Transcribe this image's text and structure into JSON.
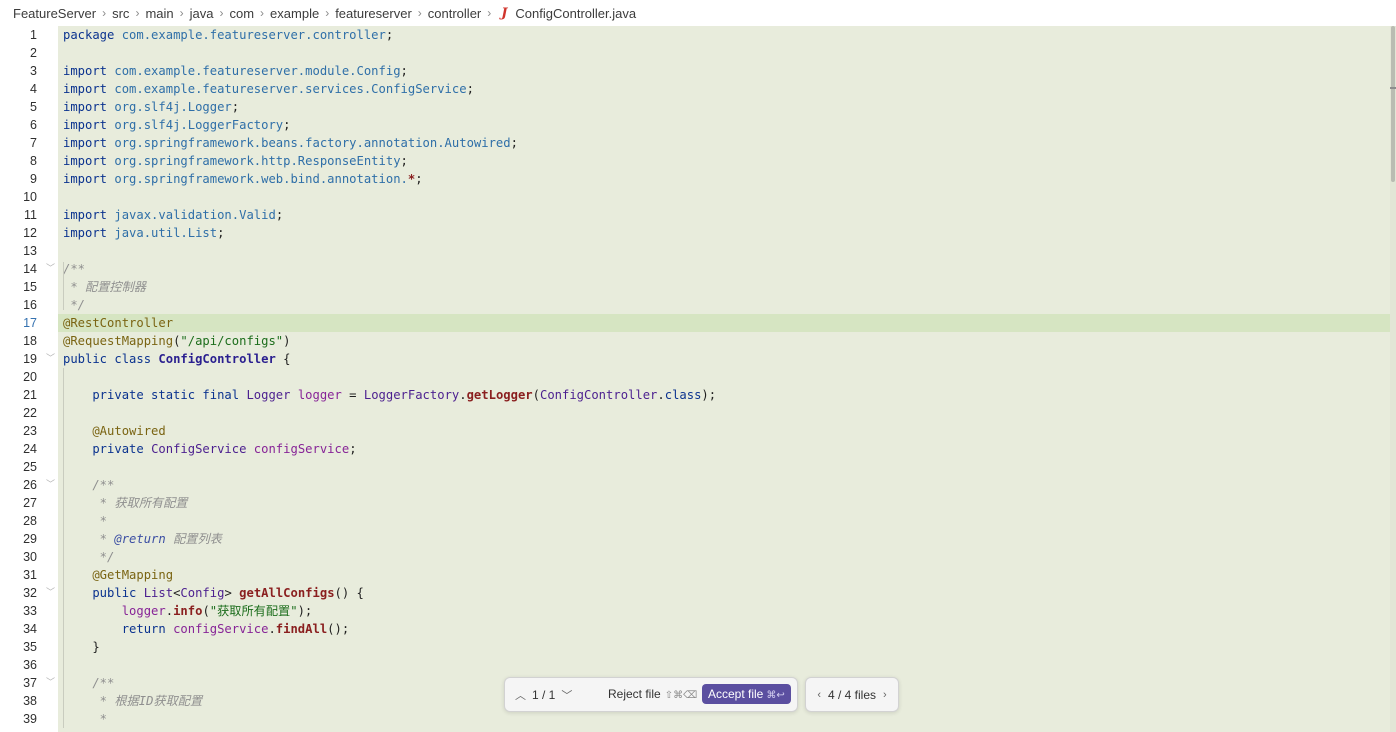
{
  "breadcrumb": {
    "items": [
      "FeatureServer",
      "src",
      "main",
      "java",
      "com",
      "example",
      "featureserver",
      "controller"
    ],
    "file_icon": "J",
    "file_name": "ConfigController.java"
  },
  "editor": {
    "current_line": 17,
    "lines": [
      {
        "n": "1",
        "t": [
          [
            "kw",
            "package "
          ],
          [
            "pk",
            "com.example.featureserver.controller"
          ],
          [
            "plain",
            ";"
          ]
        ]
      },
      {
        "n": "2",
        "t": []
      },
      {
        "n": "3",
        "t": [
          [
            "kw",
            "import "
          ],
          [
            "pk",
            "com.example.featureserver.module.Config"
          ],
          [
            "plain",
            ";"
          ]
        ]
      },
      {
        "n": "4",
        "t": [
          [
            "kw",
            "import "
          ],
          [
            "pk",
            "com.example.featureserver.services.ConfigService"
          ],
          [
            "plain",
            ";"
          ]
        ]
      },
      {
        "n": "5",
        "t": [
          [
            "kw",
            "import "
          ],
          [
            "pk",
            "org.slf4j.Logger"
          ],
          [
            "plain",
            ";"
          ]
        ]
      },
      {
        "n": "6",
        "t": [
          [
            "kw",
            "import "
          ],
          [
            "pk",
            "org.slf4j.LoggerFactory"
          ],
          [
            "plain",
            ";"
          ]
        ]
      },
      {
        "n": "7",
        "t": [
          [
            "kw",
            "import "
          ],
          [
            "pk",
            "org.springframework.beans.factory.annotation.Autowired"
          ],
          [
            "plain",
            ";"
          ]
        ]
      },
      {
        "n": "8",
        "t": [
          [
            "kw",
            "import "
          ],
          [
            "pk",
            "org.springframework.http.ResponseEntity"
          ],
          [
            "plain",
            ";"
          ]
        ]
      },
      {
        "n": "9",
        "t": [
          [
            "kw",
            "import "
          ],
          [
            "pk",
            "org.springframework.web.bind.annotation."
          ],
          [
            "mth",
            "*"
          ],
          [
            "plain",
            ";"
          ]
        ]
      },
      {
        "n": "10",
        "t": []
      },
      {
        "n": "11",
        "t": [
          [
            "kw",
            "import "
          ],
          [
            "pk",
            "javax.validation.Valid"
          ],
          [
            "plain",
            ";"
          ]
        ]
      },
      {
        "n": "12",
        "t": [
          [
            "kw",
            "import "
          ],
          [
            "pk",
            "java.util.List"
          ],
          [
            "plain",
            ";"
          ]
        ]
      },
      {
        "n": "13",
        "t": []
      },
      {
        "n": "14",
        "fold": true,
        "t": [
          [
            "cmt",
            "/**"
          ]
        ]
      },
      {
        "n": "15",
        "t": [
          [
            "cmt",
            " * 配置控制器"
          ]
        ]
      },
      {
        "n": "16",
        "t": [
          [
            "cmt",
            " */"
          ]
        ]
      },
      {
        "n": "17",
        "t": [
          [
            "ann",
            "@RestController"
          ]
        ]
      },
      {
        "n": "18",
        "t": [
          [
            "ann",
            "@RequestMapping"
          ],
          [
            "plain",
            "("
          ],
          [
            "str",
            "\"/api/configs\""
          ],
          [
            "plain",
            ")"
          ]
        ]
      },
      {
        "n": "19",
        "fold": true,
        "t": [
          [
            "kw",
            "public class "
          ],
          [
            "cls",
            "ConfigController "
          ],
          [
            "plain",
            "{"
          ]
        ]
      },
      {
        "n": "20",
        "t": []
      },
      {
        "n": "21",
        "t": [
          [
            "kw",
            "    private static final "
          ],
          [
            "ty",
            "Logger "
          ],
          [
            "fld",
            "logger"
          ],
          [
            "plain",
            " = "
          ],
          [
            "ty",
            "LoggerFactory"
          ],
          [
            "plain",
            "."
          ],
          [
            "mth",
            "getLogger"
          ],
          [
            "plain",
            "("
          ],
          [
            "ty",
            "ConfigController"
          ],
          [
            "plain",
            "."
          ],
          [
            "kw",
            "class"
          ],
          [
            "plain",
            ");"
          ]
        ]
      },
      {
        "n": "22",
        "t": []
      },
      {
        "n": "23",
        "t": [
          [
            "ann",
            "    @Autowired"
          ]
        ]
      },
      {
        "n": "24",
        "t": [
          [
            "kw",
            "    private "
          ],
          [
            "ty",
            "ConfigService "
          ],
          [
            "fld",
            "configService"
          ],
          [
            "plain",
            ";"
          ]
        ]
      },
      {
        "n": "25",
        "t": []
      },
      {
        "n": "26",
        "fold": true,
        "t": [
          [
            "cmt",
            "    /**"
          ]
        ]
      },
      {
        "n": "27",
        "t": [
          [
            "cmt",
            "     * 获取所有配置"
          ]
        ]
      },
      {
        "n": "28",
        "t": [
          [
            "cmt",
            "     *"
          ]
        ]
      },
      {
        "n": "29",
        "t": [
          [
            "cmt",
            "     * "
          ],
          [
            "cmt-tag",
            "@return"
          ],
          [
            "cmt",
            " 配置列表"
          ]
        ]
      },
      {
        "n": "30",
        "t": [
          [
            "cmt",
            "     */"
          ]
        ]
      },
      {
        "n": "31",
        "t": [
          [
            "ann",
            "    @GetMapping"
          ]
        ]
      },
      {
        "n": "32",
        "fold": true,
        "t": [
          [
            "kw",
            "    public "
          ],
          [
            "ty",
            "List"
          ],
          [
            "plain",
            "<"
          ],
          [
            "ty",
            "Config"
          ],
          [
            "plain",
            "> "
          ],
          [
            "mth",
            "getAllConfigs"
          ],
          [
            "plain",
            "() {"
          ]
        ]
      },
      {
        "n": "33",
        "t": [
          [
            "fld",
            "        logger"
          ],
          [
            "plain",
            "."
          ],
          [
            "mth",
            "info"
          ],
          [
            "plain",
            "("
          ],
          [
            "str",
            "\"获取所有配置\""
          ],
          [
            "plain",
            ");"
          ]
        ]
      },
      {
        "n": "34",
        "t": [
          [
            "kw",
            "        return "
          ],
          [
            "fld",
            "configService"
          ],
          [
            "plain",
            "."
          ],
          [
            "mth",
            "findAll"
          ],
          [
            "plain",
            "();"
          ]
        ]
      },
      {
        "n": "35",
        "t": [
          [
            "plain",
            "    }"
          ]
        ]
      },
      {
        "n": "36",
        "t": []
      },
      {
        "n": "37",
        "fold": true,
        "t": [
          [
            "cmt",
            "    /**"
          ]
        ]
      },
      {
        "n": "38",
        "t": [
          [
            "cmt",
            "     * 根据ID获取配置"
          ]
        ]
      },
      {
        "n": "39",
        "t": [
          [
            "cmt",
            "     *"
          ]
        ]
      }
    ]
  },
  "diff_toolbar": {
    "counter": "1 / 1",
    "reject_label": "Reject file",
    "reject_shortcut": "⇧⌘⌫",
    "accept_label": "Accept file",
    "accept_shortcut": "⌘↩",
    "accent_color": "#5b4fa0"
  },
  "files_nav": {
    "label": "4 / 4 files"
  },
  "icons": {
    "breadcrumb_separator": "chevron-right-icon",
    "fold_marker": "chevron-down-icon",
    "prev_change": "chevron-up-icon",
    "next_change": "chevron-down-icon",
    "prev_file": "chevron-left-icon",
    "next_file": "chevron-right-icon"
  }
}
